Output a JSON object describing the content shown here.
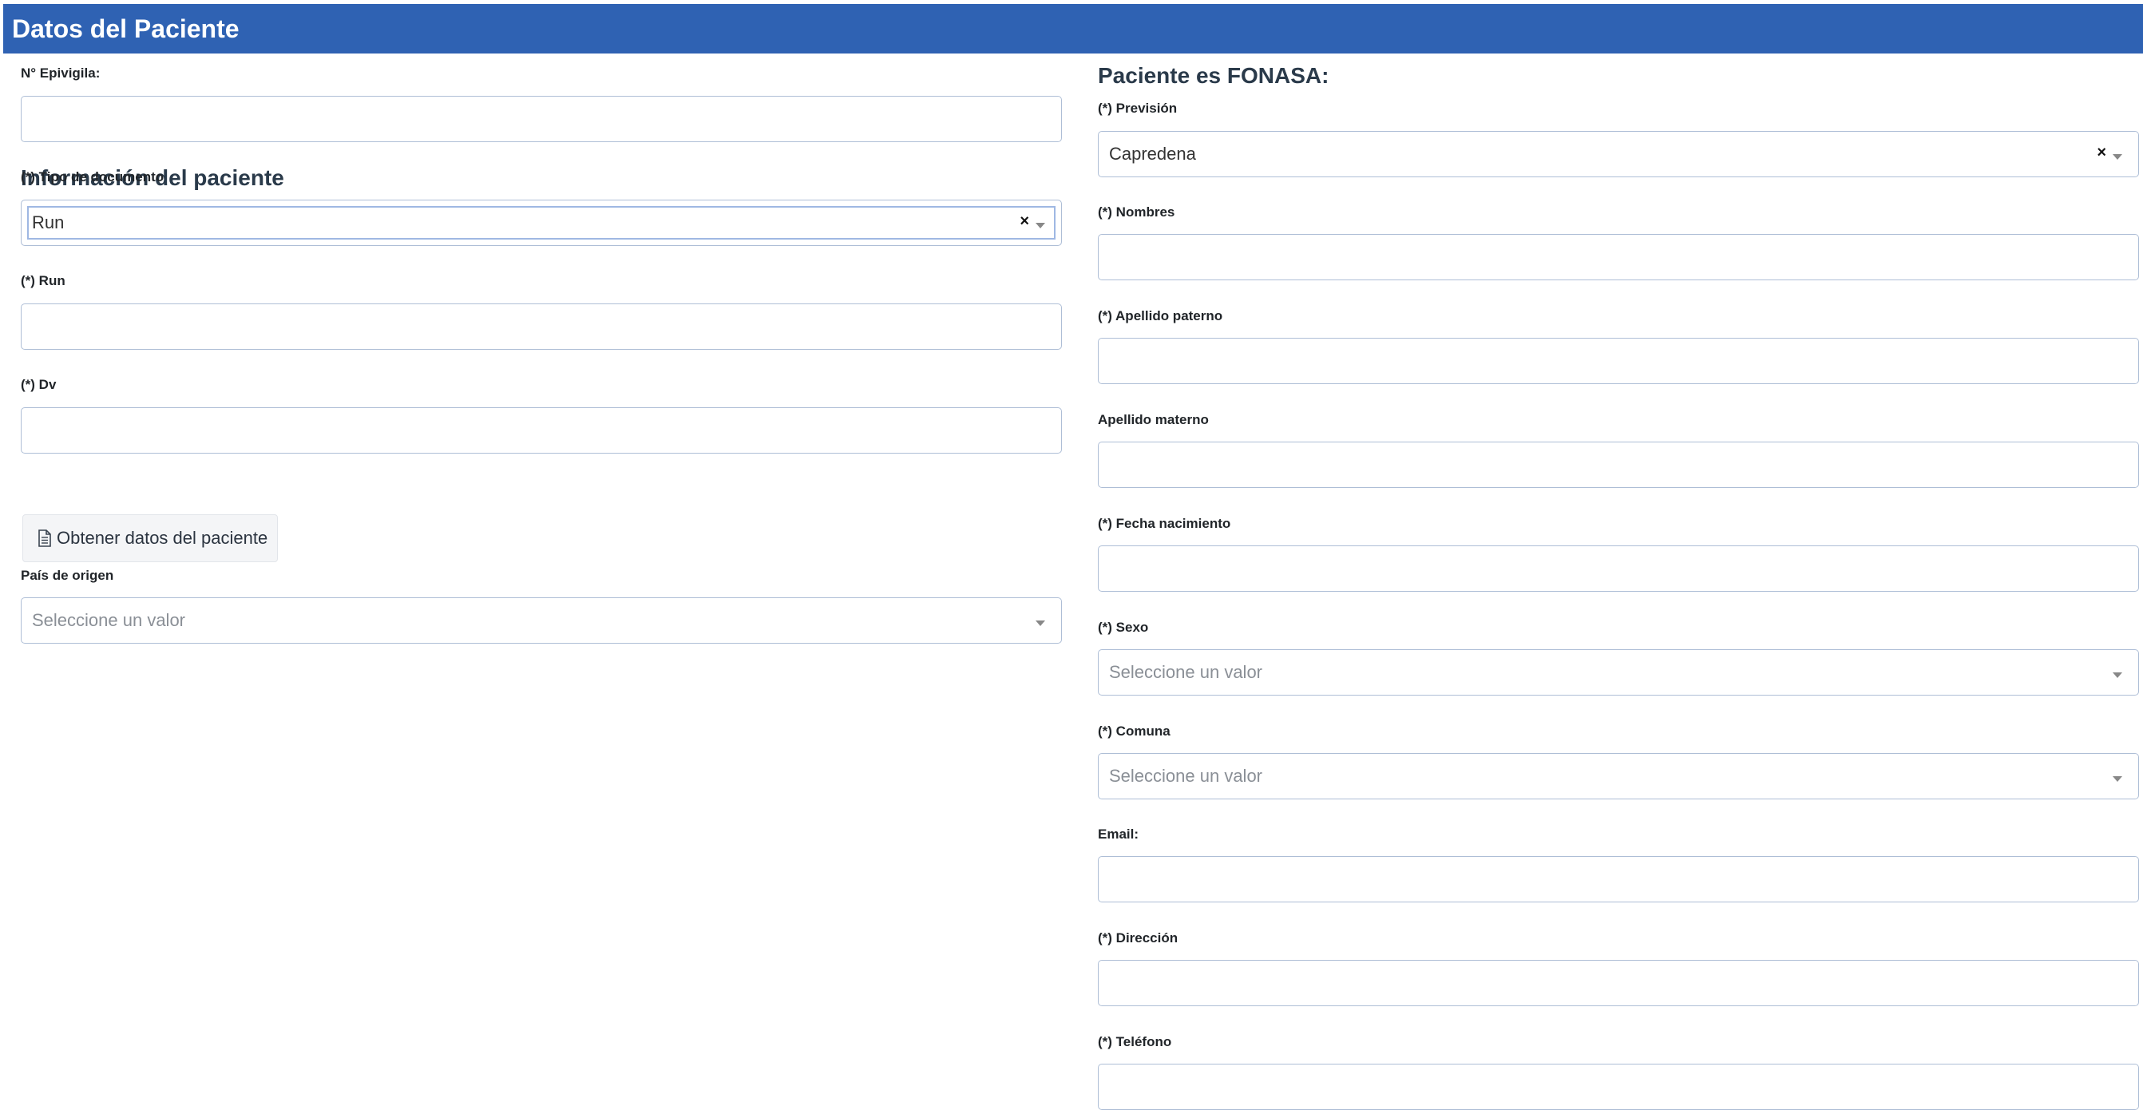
{
  "header": {
    "title": "Datos del Paciente"
  },
  "left": {
    "epivigila": {
      "label": "N° Epivigila:",
      "value": "",
      "placeholder": ""
    },
    "section_title": "Información del paciente",
    "tipo_documento": {
      "label": "(*) Tipo de documento",
      "value": "Run",
      "clear": "×"
    },
    "run": {
      "label": "(*) Run",
      "value": ""
    },
    "dv": {
      "label": "(*) Dv",
      "value": ""
    },
    "obtener_button": {
      "label": "Obtener datos del paciente"
    },
    "pais_origen": {
      "label": "País de origen",
      "placeholder": "Seleccione un valor"
    }
  },
  "right": {
    "section_title": "Paciente es FONASA:",
    "prevision": {
      "label": "(*) Previsión",
      "value": "Capredena",
      "clear": "×"
    },
    "nombres": {
      "label": "(*) Nombres",
      "value": ""
    },
    "apellido_paterno": {
      "label": "(*) Apellido paterno",
      "value": ""
    },
    "apellido_materno": {
      "label": "Apellido materno",
      "value": ""
    },
    "fecha_nacimiento": {
      "label": "(*) Fecha nacimiento",
      "value": ""
    },
    "sexo": {
      "label": "(*) Sexo",
      "placeholder": "Seleccione un valor"
    },
    "comuna": {
      "label": "(*) Comuna",
      "placeholder": "Seleccione un valor"
    },
    "email": {
      "label": "Email:",
      "value": ""
    },
    "direccion": {
      "label": "(*) Dirección",
      "value": ""
    },
    "telefono": {
      "label": "(*) Teléfono",
      "value": ""
    }
  }
}
